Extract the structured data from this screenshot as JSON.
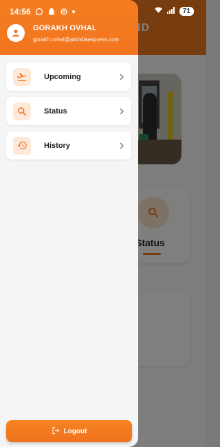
{
  "status_bar": {
    "time": "14:56",
    "battery": "71",
    "icons": [
      "whatsapp-icon",
      "snapchat-icon",
      "threads-icon",
      "wifi-icon",
      "signal-icon"
    ]
  },
  "background": {
    "header_text": "ID",
    "card_label": "Status"
  },
  "drawer": {
    "user": {
      "name": "GORAKH OVHAL",
      "email": "gorakh.ovhal@airindiaexpress.com"
    },
    "menu": [
      {
        "label": "Upcoming",
        "icon": "flight-departure-icon"
      },
      {
        "label": "Status",
        "icon": "search-icon"
      },
      {
        "label": "History",
        "icon": "history-icon"
      }
    ],
    "logout_label": "Logout"
  },
  "colors": {
    "accent": "#f27520",
    "icon_bg": "#fde9da"
  }
}
